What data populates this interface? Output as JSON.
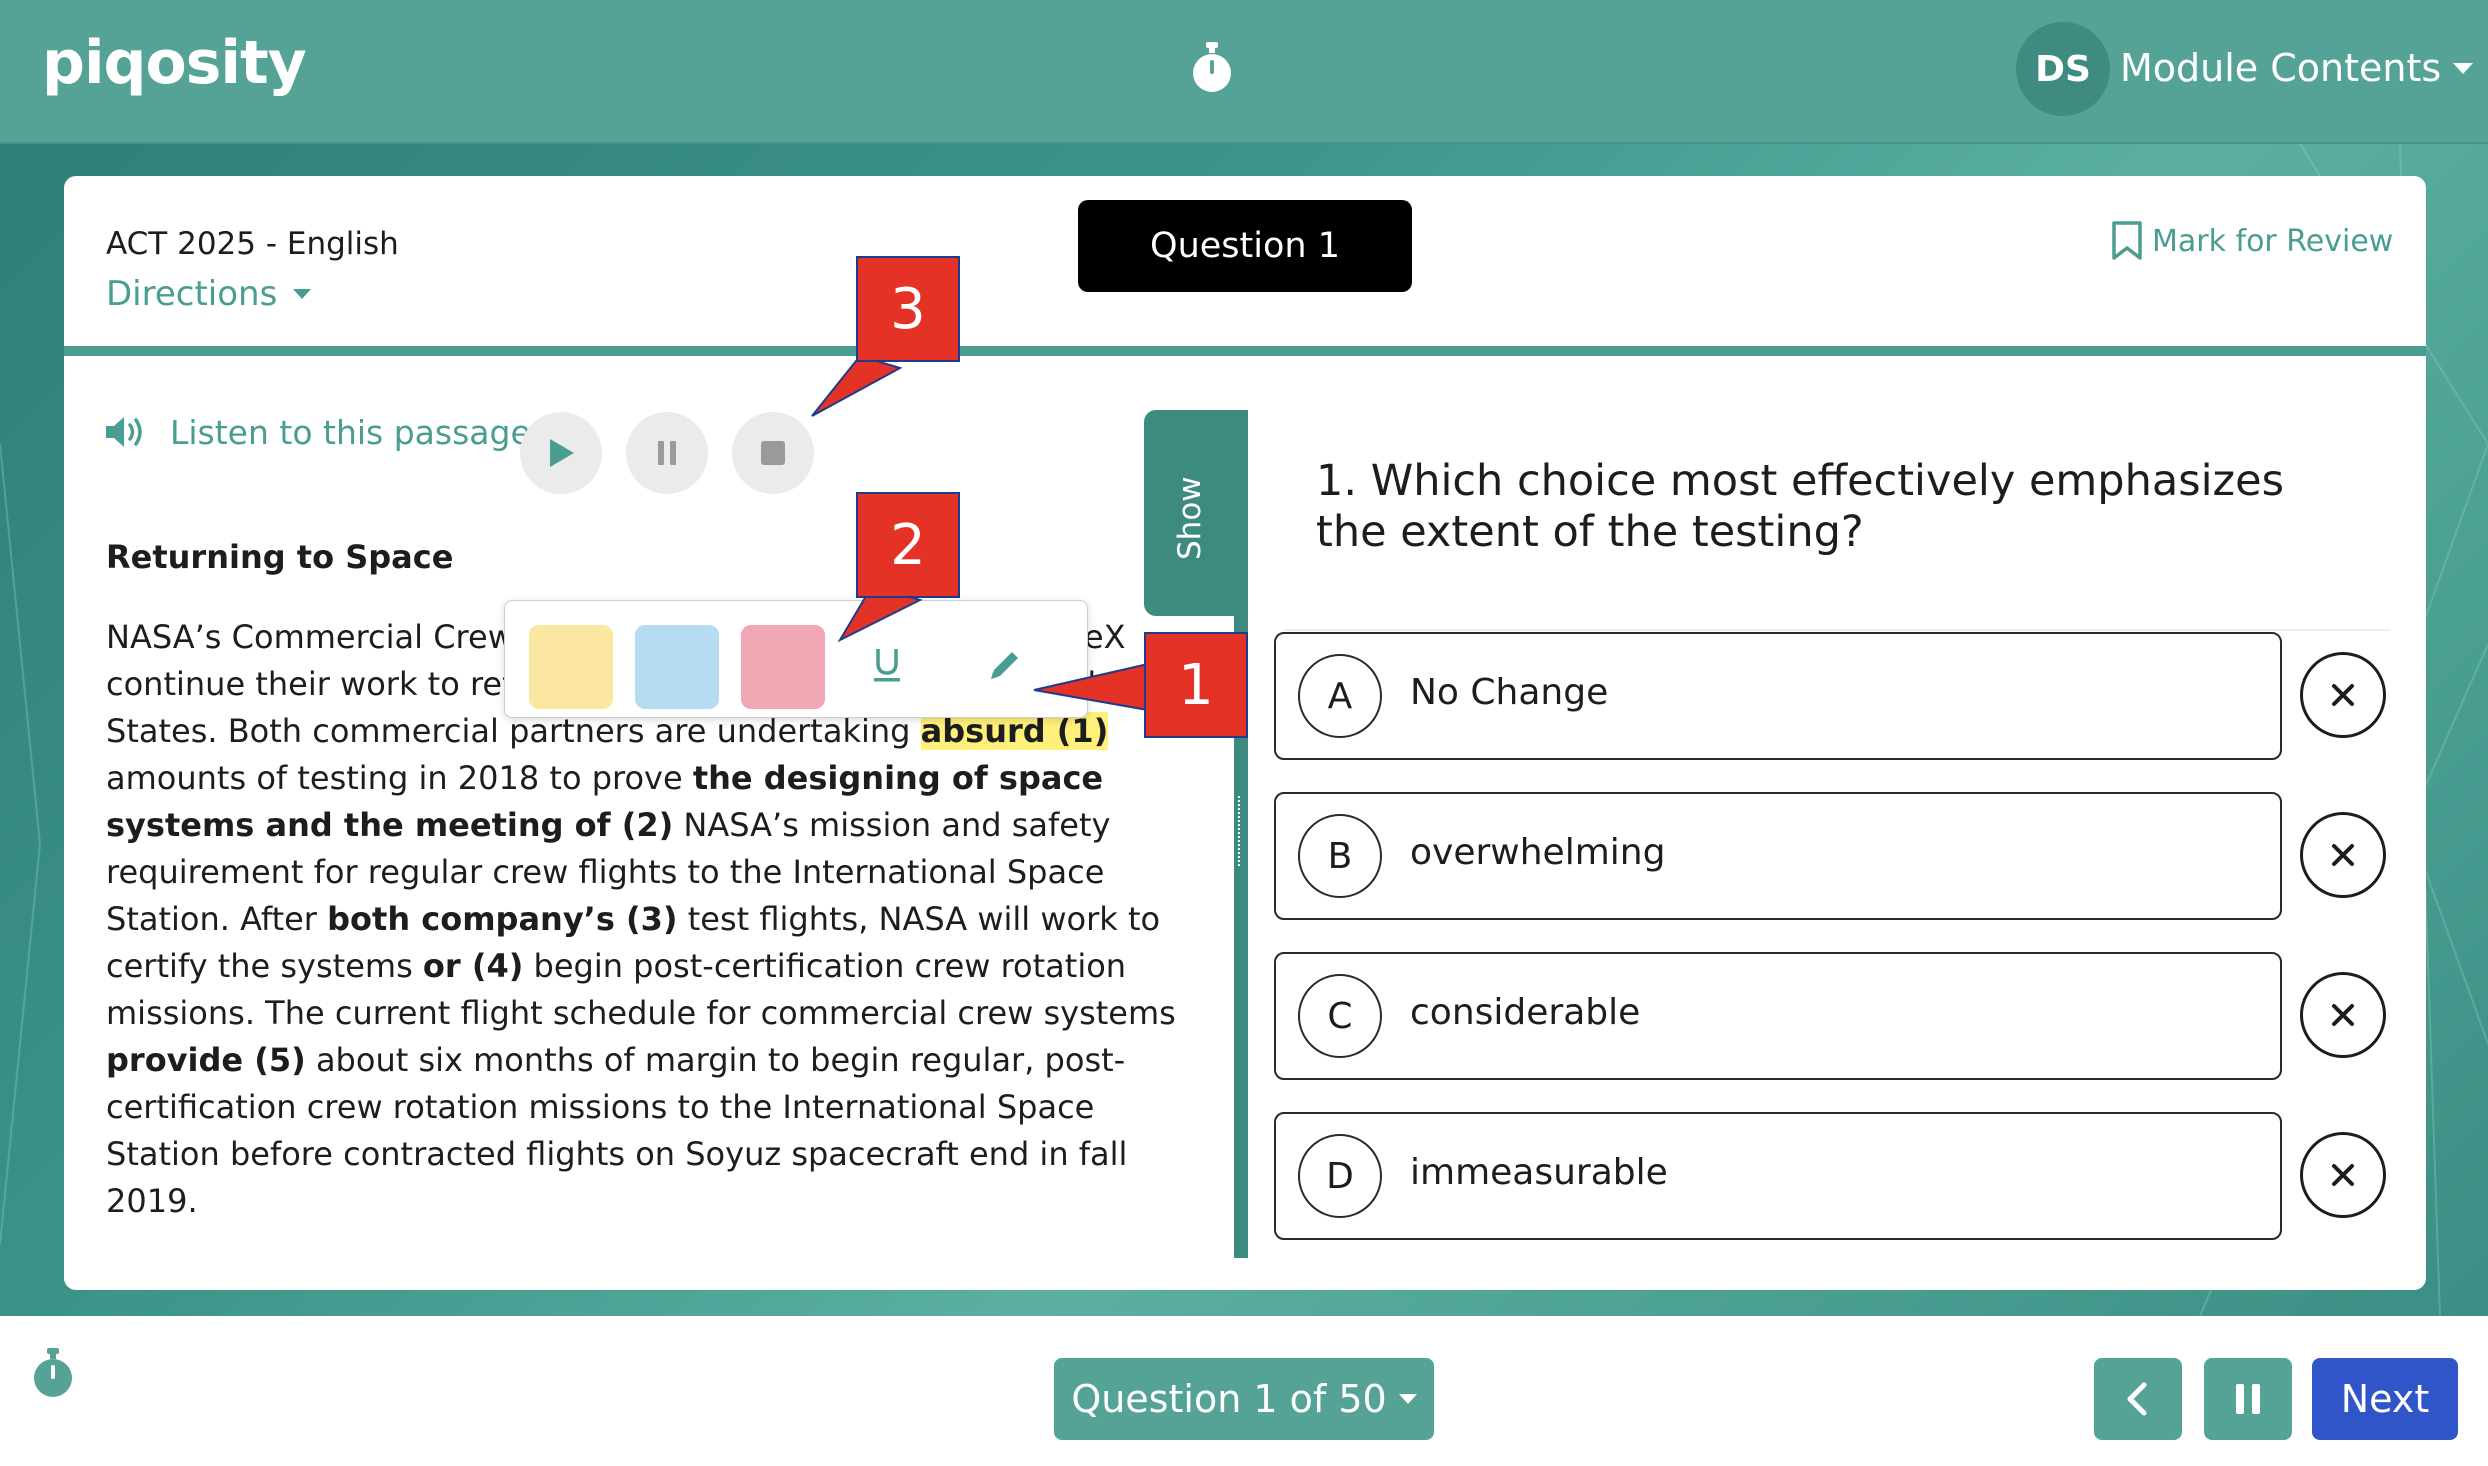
{
  "header": {
    "logo": "piqosity",
    "avatar_initials": "DS",
    "module_menu_label": "Module Contents"
  },
  "exam": {
    "title": "ACT 2025 - English",
    "directions_label": "Directions",
    "question_pill": "Question 1",
    "mark_for_review": "Mark for Review"
  },
  "passage": {
    "listen_label": "Listen to this passage",
    "title": "Returning to Space",
    "show_tab": "Show"
  },
  "question": {
    "text": "1. Which choice most effectively emphasizes the extent of the testing?",
    "choices": [
      {
        "letter": "A",
        "text": "No Change"
      },
      {
        "letter": "B",
        "text": "overwhelming"
      },
      {
        "letter": "C",
        "text": "considerable"
      },
      {
        "letter": "D",
        "text": "immeasurable"
      }
    ]
  },
  "callouts": [
    "1",
    "2",
    "3"
  ],
  "footer": {
    "question_nav": "Question 1 of 50",
    "next_label": "Next"
  },
  "colors": {
    "teal": "#55a397",
    "teal_dark": "#3d8b80",
    "accent_text": "#4a9d91",
    "next_blue": "#2f55c8",
    "highlight_yellow": "#fff07a",
    "swatch_yellow": "#fbe7a0",
    "swatch_blue": "#b6dcf2",
    "swatch_pink": "#f2a8b4",
    "callout_red": "#e53227"
  },
  "icons": [
    "stopwatch-icon",
    "speaker-icon",
    "play-icon",
    "pause-icon",
    "stop-icon",
    "bookmark-icon",
    "underline-icon",
    "pencil-icon",
    "close-icon",
    "chevron-left-icon"
  ]
}
